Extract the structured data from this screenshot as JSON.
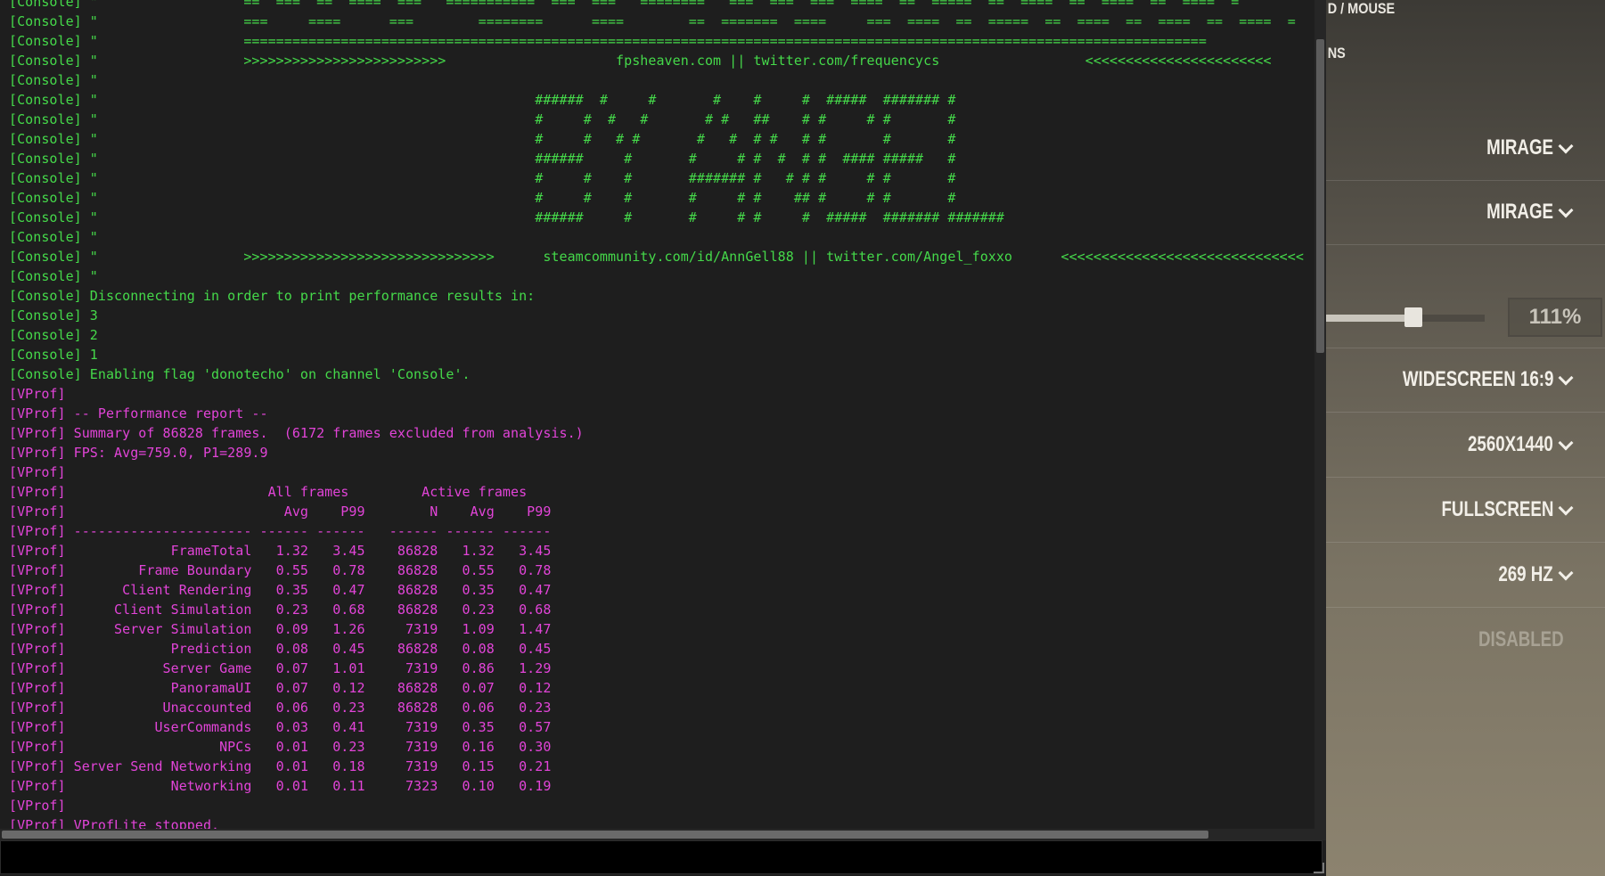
{
  "console": {
    "lines": [
      {
        "c": "green",
        "t": "[Console] \"                  ==  ===  ==  ====  ===   ===========  ===  ===   ========   ===  ===  ===  ====  ==  =====  ==  ====  ==  ====  ==  ====  ="
      },
      {
        "c": "green",
        "t": "[Console] \"                  ===     ====      ===        ========      ====        ==  =======  ====     ===  ====  ==  =====  ==  ====  ==  ====  ==  ====  ="
      },
      {
        "c": "green",
        "t": "[Console] \"                  ======================================================================================================================="
      },
      {
        "c": "green",
        "t": "[Console] \"                  >>>>>>>>>>>>>>>>>>>>>>>>>                     fpsheaven.com || twitter.com/frequencycs                  <<<<<<<<<<<<<<<<<<<<<<<"
      },
      {
        "c": "green",
        "t": "[Console] \""
      },
      {
        "c": "green",
        "t": "[Console] \"                                                      ######  #     #       #    #     #  #####  ####### #"
      },
      {
        "c": "green",
        "t": "[Console] \"                                                      #     #  #   #       # #   ##    # #     # #       #"
      },
      {
        "c": "green",
        "t": "[Console] \"                                                      #     #   # #       #   #  # #   # #       #       #"
      },
      {
        "c": "green",
        "t": "[Console] \"                                                      ######     #       #     # #  #  # #  #### #####   #"
      },
      {
        "c": "green",
        "t": "[Console] \"                                                      #     #    #       ####### #   # # #     # #       #"
      },
      {
        "c": "green",
        "t": "[Console] \"                                                      #     #    #       #     # #    ## #     # #       #"
      },
      {
        "c": "green",
        "t": "[Console] \"                                                      ######     #       #     # #     #  #####  ####### #######"
      },
      {
        "c": "green",
        "t": "[Console] \""
      },
      {
        "c": "green",
        "t": "[Console] \"                  >>>>>>>>>>>>>>>>>>>>>>>>>>>>>>>      steamcommunity.com/id/AnnGell88 || twitter.com/Angel_foxxo      <<<<<<<<<<<<<<<<<<<<<<<<<<<<<<"
      },
      {
        "c": "green",
        "t": "[Console] \""
      },
      {
        "c": "green",
        "t": "[Console] Disconnecting in order to print performance results in:"
      },
      {
        "c": "green",
        "t": "[Console] 3"
      },
      {
        "c": "green",
        "t": "[Console] 2"
      },
      {
        "c": "green",
        "t": "[Console] 1"
      },
      {
        "c": "green",
        "t": "[Console] Enabling flag 'donotecho' on channel 'Console'."
      },
      {
        "c": "magenta",
        "t": "[VProf]"
      },
      {
        "c": "magenta",
        "t": "[VProf] -- Performance report --"
      },
      {
        "c": "magenta",
        "t": "[VProf] Summary of 86828 frames.  (6172 frames excluded from analysis.)"
      },
      {
        "c": "magenta",
        "t": "[VProf] FPS: Avg=759.0, P1=289.9"
      },
      {
        "c": "magenta",
        "t": "[VProf]"
      },
      {
        "c": "magenta",
        "t": "[VProf]                         All frames         Active frames"
      },
      {
        "c": "magenta",
        "t": "[VProf]                           Avg    P99        N    Avg    P99"
      },
      {
        "c": "magenta",
        "t": "[VProf] ---------------------- ------ ------   ------ ------ ------"
      },
      {
        "c": "magenta",
        "t": "[VProf]             FrameTotal   1.32   3.45    86828   1.32   3.45"
      },
      {
        "c": "magenta",
        "t": "[VProf]         Frame Boundary   0.55   0.78    86828   0.55   0.78"
      },
      {
        "c": "magenta",
        "t": "[VProf]       Client Rendering   0.35   0.47    86828   0.35   0.47"
      },
      {
        "c": "magenta",
        "t": "[VProf]      Client Simulation   0.23   0.68    86828   0.23   0.68"
      },
      {
        "c": "magenta",
        "t": "[VProf]      Server Simulation   0.09   1.26     7319   1.09   1.47"
      },
      {
        "c": "magenta",
        "t": "[VProf]             Prediction   0.08   0.45    86828   0.08   0.45"
      },
      {
        "c": "magenta",
        "t": "[VProf]            Server Game   0.07   1.01     7319   0.86   1.29"
      },
      {
        "c": "magenta",
        "t": "[VProf]             PanoramaUI   0.07   0.12    86828   0.07   0.12"
      },
      {
        "c": "magenta",
        "t": "[VProf]            Unaccounted   0.06   0.23    86828   0.06   0.23"
      },
      {
        "c": "magenta",
        "t": "[VProf]           UserCommands   0.03   0.41     7319   0.35   0.57"
      },
      {
        "c": "magenta",
        "t": "[VProf]                   NPCs   0.01   0.23     7319   0.16   0.30"
      },
      {
        "c": "magenta",
        "t": "[VProf] Server Send Networking   0.01   0.18     7319   0.15   0.21"
      },
      {
        "c": "magenta",
        "t": "[VProf]             Networking   0.01   0.11     7323   0.10   0.19"
      },
      {
        "c": "magenta",
        "t": "[VProf]"
      },
      {
        "c": "magenta",
        "t": "[VProf] VProfLite stopped."
      }
    ],
    "input_value": ""
  },
  "settings": {
    "header_partial": "D / MOUSE",
    "subheader_partial": "NS",
    "rows": [
      {
        "value": "MIRAGE",
        "disabled": false
      },
      {
        "value": "MIRAGE",
        "disabled": false
      },
      {
        "value": "WIDESCREEN 16:9",
        "disabled": false
      },
      {
        "value": "2560X1440",
        "disabled": false
      },
      {
        "value": "FULLSCREEN",
        "disabled": false
      },
      {
        "value": "269 HZ",
        "disabled": false
      },
      {
        "value": "DISABLED",
        "disabled": true
      }
    ],
    "zoom": {
      "value": "111%",
      "slider_fraction": 0.55
    }
  }
}
